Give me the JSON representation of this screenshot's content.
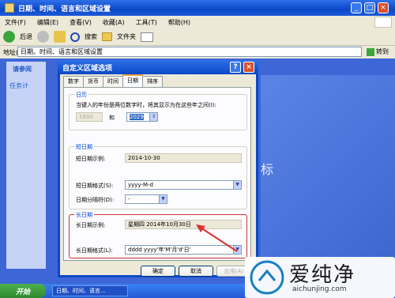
{
  "explorer": {
    "title": "日期、时间、语言和区域设置",
    "menu": [
      "文件(F)",
      "编辑(E)",
      "查看(V)",
      "收藏(A)",
      "工具(T)",
      "帮助(H)"
    ],
    "toolbar": {
      "back": "后退",
      "search": "搜索",
      "folders": "文件夹"
    },
    "address_label": "地址(D)",
    "address_value": "日期、时间、语言和区域设置",
    "go_label": "转到",
    "tasks_pane_title": "请参阅",
    "tasks_pane_item": "任务计",
    "bg_text": "标"
  },
  "dialog": {
    "title": "自定义区域选项",
    "help": "?",
    "close": "×",
    "tabs": [
      "数字",
      "货币",
      "时间",
      "日期",
      "排序"
    ],
    "active_tab": "日期",
    "calendar": {
      "title": "日历",
      "desc": "当键入的年份是两位数字时，将其显示为在这些年之间(I):",
      "from_year": "1930",
      "and": "和",
      "to_year": "2029"
    },
    "short_date": {
      "title": "短日期",
      "sample_label": "短日期示例:",
      "sample_value": "2014-10-30",
      "format_label": "短日期格式(S):",
      "format_value": "yyyy-M-d",
      "separator_label": "日期分隔符(D):",
      "separator_value": "-"
    },
    "long_date": {
      "title": "长日期",
      "sample_label": "长日期示例:",
      "sample_value": "星期四 2014年10月30日",
      "format_label": "长日期格式(L):",
      "format_value": "dddd yyyy'年'M'月'd'日'"
    },
    "buttons": {
      "ok": "确定",
      "cancel": "取消",
      "apply": "应用(A)"
    }
  },
  "taskbar": {
    "start": "开始",
    "task": "日期、时间、语言..."
  },
  "watermark": {
    "brand": "爱纯净",
    "url": "aichunjing.com"
  },
  "colors": {
    "xp_blue": "#0a48c8",
    "start_green": "#2f8a2f",
    "annotation_red": "#e03030"
  }
}
